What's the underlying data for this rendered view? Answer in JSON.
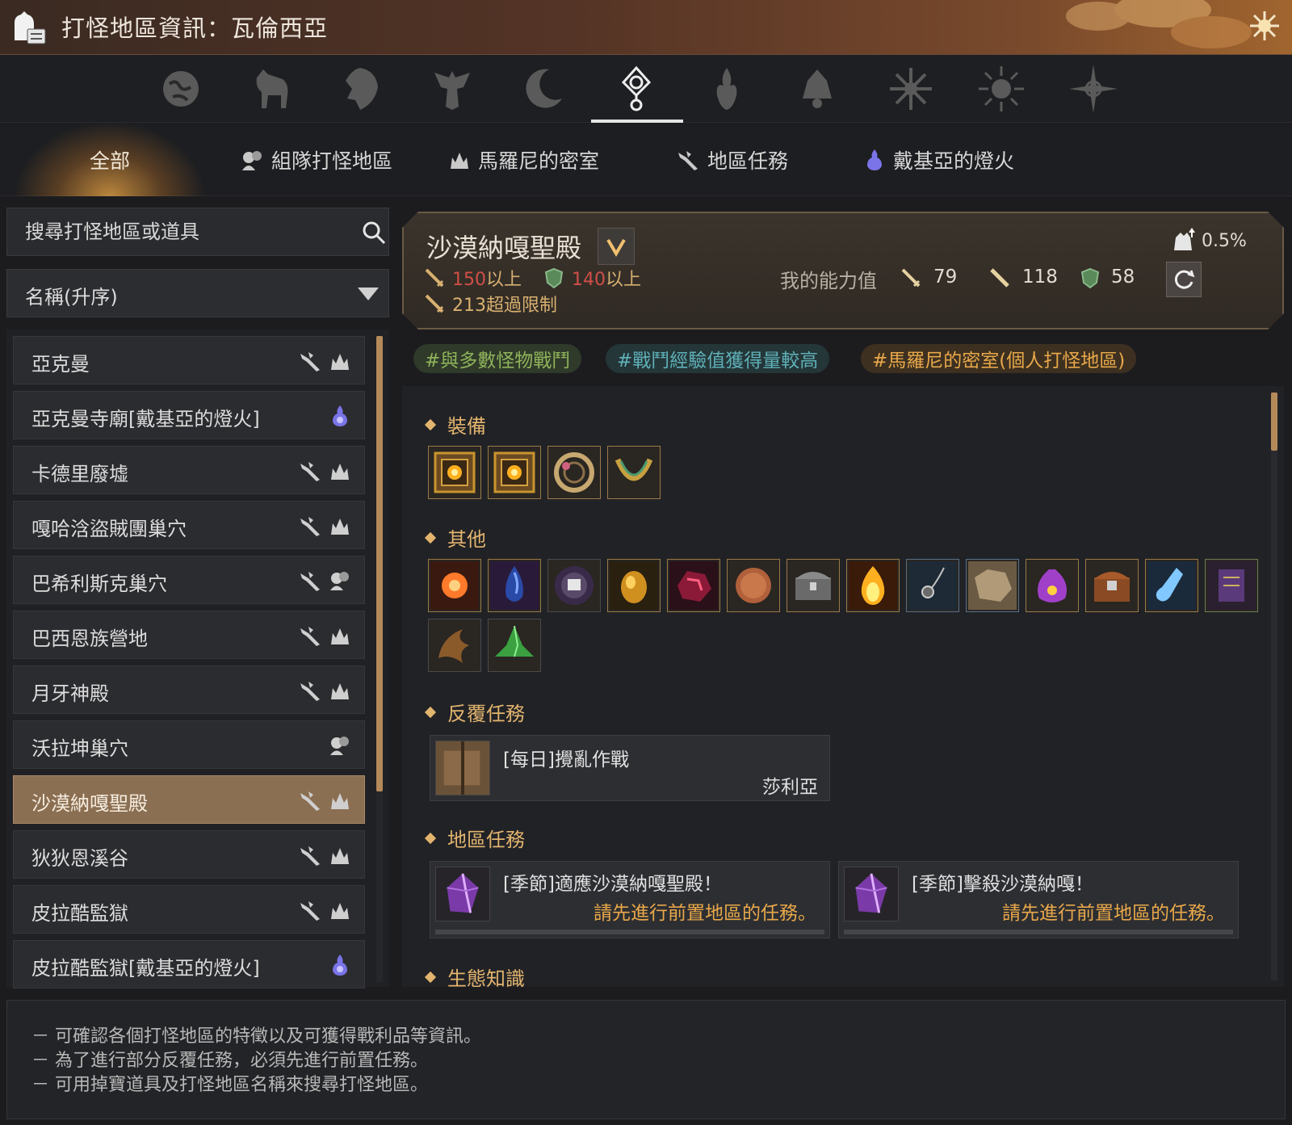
{
  "window": {
    "title": "打怪地區資訊：瓦倫西亞"
  },
  "regions": [
    {
      "icon": "globe-icon"
    },
    {
      "icon": "horse-icon"
    },
    {
      "icon": "lion-icon"
    },
    {
      "icon": "eagle-crest-icon"
    },
    {
      "icon": "crescent-moon-icon"
    },
    {
      "icon": "valencia-sun-emblem-icon",
      "selected": true
    },
    {
      "icon": "flame-crest-icon"
    },
    {
      "icon": "bell-crest-icon"
    },
    {
      "icon": "star-burst-icon"
    },
    {
      "icon": "sun-burst-icon"
    },
    {
      "icon": "compass-star-icon"
    }
  ],
  "categories": {
    "all": "全部",
    "party": "組隊打怪地區",
    "marni": "馬羅尼的密室",
    "quests": "地區任務",
    "dehkia": "戴基亞的燈火"
  },
  "search": {
    "placeholder": "搜尋打怪地區或道具"
  },
  "sort": {
    "selected": "名稱(升序)"
  },
  "zones": [
    {
      "name": "亞克曼",
      "icons": [
        "node-quest-icon",
        "marni-icon"
      ]
    },
    {
      "name": "亞克曼寺廟[戴基亞的燈火]",
      "icons": [
        "dehkia-lamp-icon"
      ]
    },
    {
      "name": "卡德里廢墟",
      "icons": [
        "node-quest-icon",
        "marni-icon"
      ]
    },
    {
      "name": "嘎哈浛盜賊團巢穴",
      "icons": [
        "node-quest-icon",
        "marni-icon"
      ]
    },
    {
      "name": "巴希利斯克巢穴",
      "icons": [
        "node-quest-icon",
        "party-icon"
      ]
    },
    {
      "name": "巴西恩族營地",
      "icons": [
        "node-quest-icon",
        "marni-icon"
      ]
    },
    {
      "name": "月牙神殿",
      "icons": [
        "node-quest-icon",
        "marni-icon"
      ]
    },
    {
      "name": "沃拉坤巢穴",
      "icons": [
        "party-icon"
      ]
    },
    {
      "name": "沙漠納嘎聖殿",
      "icons": [
        "node-quest-icon",
        "marni-icon"
      ],
      "selected": true
    },
    {
      "name": "狄狄恩溪谷",
      "icons": [
        "node-quest-icon",
        "marni-icon"
      ]
    },
    {
      "name": "皮拉酷監獄",
      "icons": [
        "node-quest-icon",
        "marni-icon"
      ]
    },
    {
      "name": "皮拉酷監獄[戴基亞的燈火]",
      "icons": [
        "dehkia-lamp-icon"
      ]
    }
  ],
  "detail": {
    "name": "沙漠納嘎聖殿",
    "ap_req": "150",
    "ap_suffix": "以上",
    "dp_req": "140",
    "dp_suffix": "以上",
    "cap_value": "213",
    "cap_suffix": "超過限制",
    "my_stats_label": "我的能力值",
    "my_ap": "79",
    "my_aap": "118",
    "my_dp": "58",
    "drop_rate": "0.5%"
  },
  "tags": [
    {
      "text": "#與多數怪物戰鬥",
      "color": "#8fb35a",
      "bg": "#2f3a2a"
    },
    {
      "text": "#戰鬥經驗值獲得量較高",
      "color": "#5fb0b8",
      "bg": "#243638"
    },
    {
      "text": "#馬羅尼的密室(個人打怪地區)",
      "color": "#e8a84a",
      "bg": "#3d3020"
    }
  ],
  "sections": {
    "equipment": "裝備",
    "other": "其他",
    "repeat_quests": "反覆任務",
    "zone_quests": "地區任務",
    "ecology": "生態知識"
  },
  "equipment_items": [
    "accessory-box-icon",
    "accessory-box-icon",
    "compass-ring-icon",
    "necklace-icon"
  ],
  "other_items": [
    "black-stone-icon",
    "blue-crystal-icon",
    "orb-icon",
    "golden-egg-icon",
    "red-ore-icon",
    "copper-coin-icon",
    "treasure-chest-icon",
    "gold-flame-icon",
    "pendant-icon",
    "rough-stone-icon",
    "pouch-icon",
    "loot-chest-icon",
    "potion-icon",
    "scroll-icon",
    "claw-icon",
    "green-crystal-icon"
  ],
  "repeat_quest": {
    "title": "[每日]攪亂作戰",
    "npc": "莎利亞"
  },
  "zone_quests": [
    {
      "title": "[季節]適應沙漠納嘎聖殿！",
      "note": "請先進行前置地區的任務。"
    },
    {
      "title": "[季節]擊殺沙漠納嘎！",
      "note": "請先進行前置地區的任務。"
    }
  ],
  "footer": {
    "line1": "－ 可確認各個打怪地區的特徵以及可獲得戰利品等資訊。",
    "line2": "－ 為了進行部分反覆任務，必須先進行前置任務。",
    "line3": "－ 可用掉寶道具及打怪地區名稱來搜尋打怪地區。"
  },
  "colors": {
    "accent": "#e2b46e",
    "selected_row": "#8b6f52",
    "requirement_red": "#d04f47"
  }
}
